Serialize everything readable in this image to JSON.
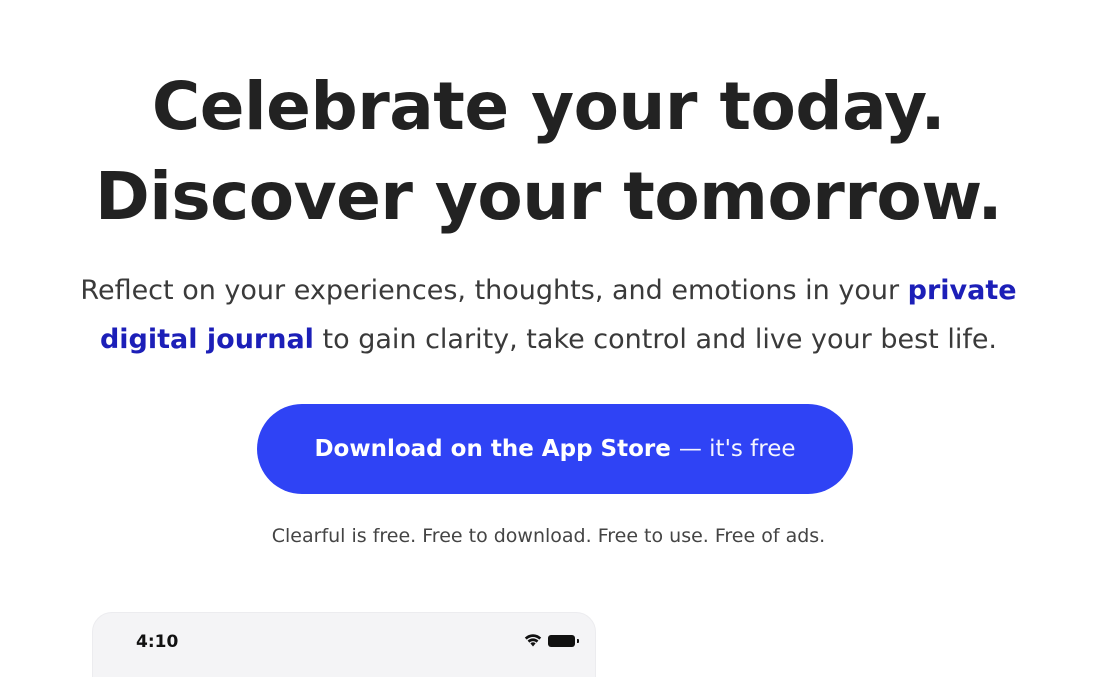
{
  "hero": {
    "headline_line1": "Celebrate your today.",
    "headline_line2": "Discover your tomorrow.",
    "subhead_before": "Reflect on your experiences, thoughts, and emotions in your ",
    "subhead_accent": "private digital journal",
    "subhead_after": " to gain clarity, take control and live your best life."
  },
  "cta": {
    "label_strong": "Download on the App Store",
    "label_light": "— it's free"
  },
  "free_note": "Clearful is free. Free to download. Free to use. Free of ads.",
  "phone_preview": {
    "status_time": "4:10",
    "icons": [
      "wifi-icon",
      "battery-icon"
    ]
  },
  "colors": {
    "accent_text": "#1c1fb8",
    "button_bg": "#2f43f5",
    "headline": "#222222"
  }
}
